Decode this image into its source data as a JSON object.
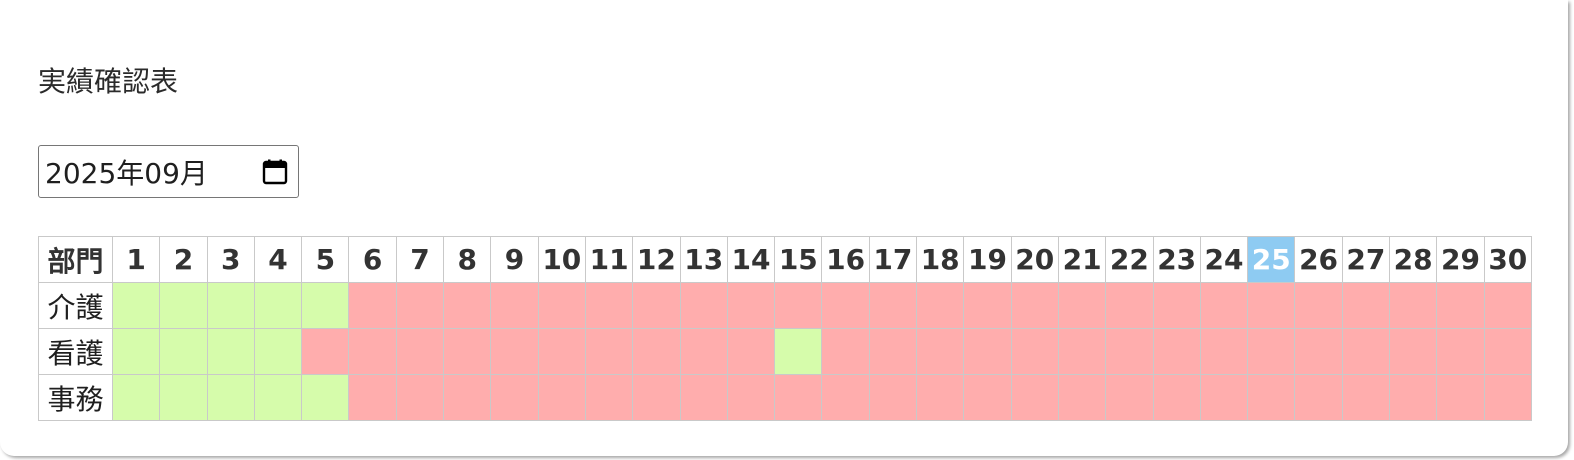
{
  "page": {
    "title": "実績確認表",
    "month_input_value": "2025年09月"
  },
  "colors": {
    "done": "#d6fcab",
    "not_done": "#ffadad",
    "today": "#8ecbf2"
  },
  "table": {
    "header_label": "部門",
    "days": [
      "1",
      "2",
      "3",
      "4",
      "5",
      "6",
      "7",
      "8",
      "9",
      "10",
      "11",
      "12",
      "13",
      "14",
      "15",
      "16",
      "17",
      "18",
      "19",
      "20",
      "21",
      "22",
      "23",
      "24",
      "25",
      "26",
      "27",
      "28",
      "29",
      "30"
    ],
    "today": "25",
    "rows": [
      {
        "dept": "介護",
        "status": [
          1,
          1,
          1,
          1,
          1,
          0,
          0,
          0,
          0,
          0,
          0,
          0,
          0,
          0,
          0,
          0,
          0,
          0,
          0,
          0,
          0,
          0,
          0,
          0,
          0,
          0,
          0,
          0,
          0,
          0
        ]
      },
      {
        "dept": "看護",
        "status": [
          1,
          1,
          1,
          1,
          0,
          0,
          0,
          0,
          0,
          0,
          0,
          0,
          0,
          0,
          1,
          0,
          0,
          0,
          0,
          0,
          0,
          0,
          0,
          0,
          0,
          0,
          0,
          0,
          0,
          0
        ]
      },
      {
        "dept": "事務",
        "status": [
          1,
          1,
          1,
          1,
          1,
          0,
          0,
          0,
          0,
          0,
          0,
          0,
          0,
          0,
          0,
          0,
          0,
          0,
          0,
          0,
          0,
          0,
          0,
          0,
          0,
          0,
          0,
          0,
          0,
          0
        ]
      }
    ]
  },
  "icons": {
    "calendar": "calendar-icon"
  }
}
